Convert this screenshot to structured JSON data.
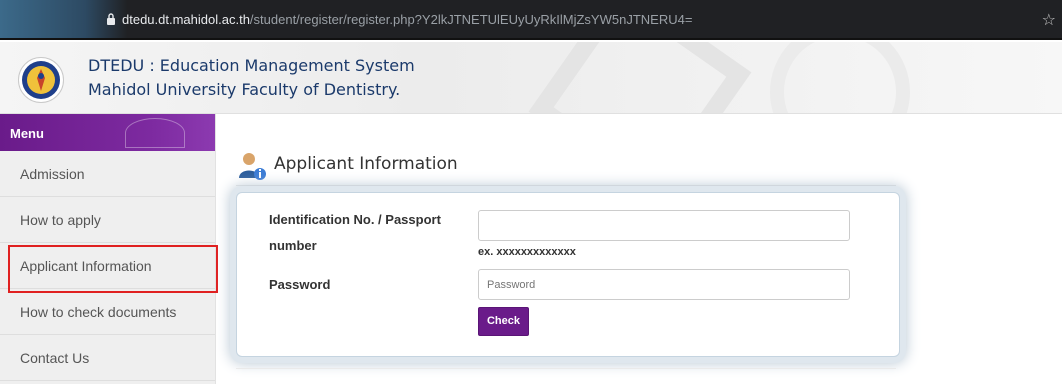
{
  "browser": {
    "url_host": "dtedu.dt.mahidol.ac.th",
    "url_path": "/student/register/register.php?Y2lkJTNETUlEUyUyRkIlMjZsYW5nJTNERU4=",
    "icons": {
      "lock": "lock-icon",
      "star": "star-icon"
    }
  },
  "header": {
    "title": "DTEDU : Education Management System",
    "subtitle": "Mahidol University Faculty of Dentistry."
  },
  "sidebar": {
    "menu_label": "Menu",
    "items": [
      {
        "label": "Admission"
      },
      {
        "label": "How to apply"
      },
      {
        "label": "Applicant Information",
        "selected": true
      },
      {
        "label": "How to check documents"
      },
      {
        "label": "Contact Us"
      }
    ]
  },
  "main": {
    "page_title": "Applicant Information",
    "form": {
      "id_label": "Identification No. / Passport number",
      "id_value": "",
      "id_example": "ex. xxxxxxxxxxxxx",
      "password_label": "Password",
      "password_placeholder": "Password",
      "password_value": "",
      "check_label": "Check"
    }
  },
  "colors": {
    "accent_purple": "#6a1b8a",
    "header_text": "#1b3a6b",
    "highlight_red": "#e02020"
  }
}
